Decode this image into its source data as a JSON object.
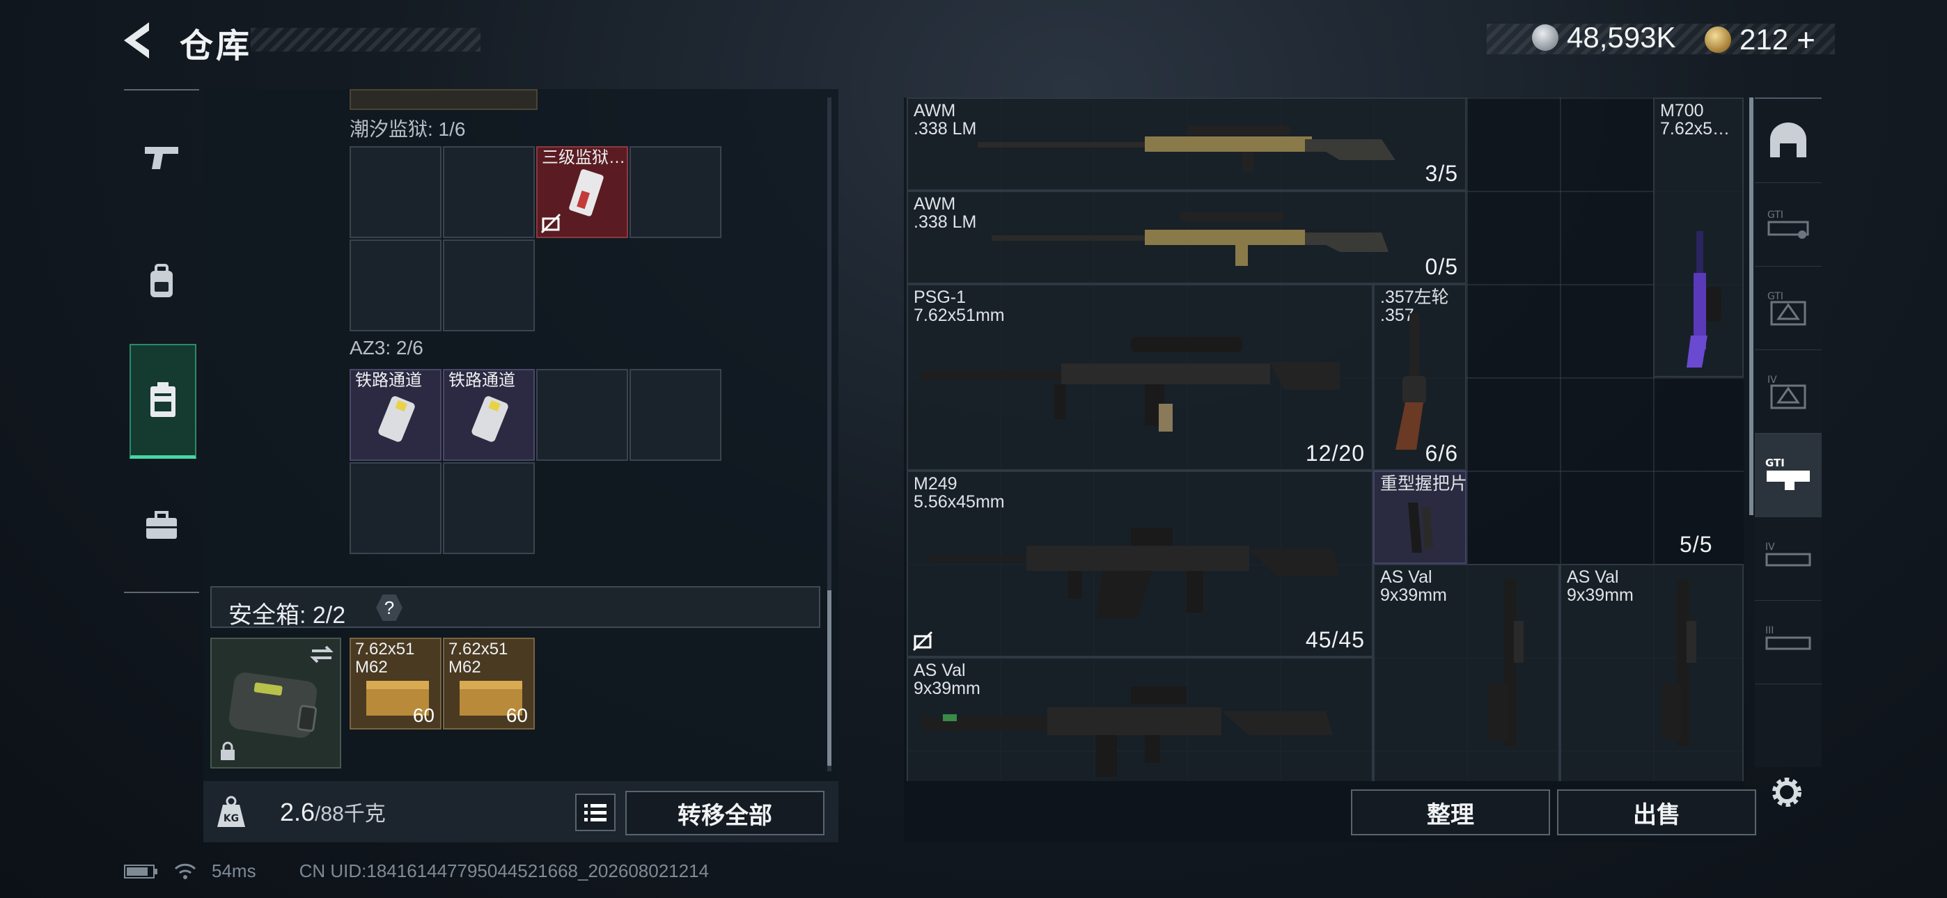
{
  "header": {
    "title": "仓库",
    "currency": [
      {
        "icon": "silver-coin-icon",
        "value": "48,593K"
      },
      {
        "icon": "gold-coin-icon",
        "value": "212",
        "suffix": "+"
      }
    ]
  },
  "left_nav": [
    "pistol-icon",
    "backpack-icon",
    "safe-case-icon",
    "toolbox-icon"
  ],
  "stash": {
    "sections": [
      {
        "label": "潮汐监狱: 1/6",
        "items": [
          {
            "name": "三级监狱…",
            "status": "locked-transfer"
          }
        ]
      },
      {
        "label": "AZ3: 2/6",
        "items": [
          {
            "name": "铁路通道"
          },
          {
            "name": "铁路通道"
          }
        ]
      }
    ],
    "safe_box": {
      "label": "安全箱: 2/2",
      "help": "?",
      "items": [
        {
          "name": "7.62x51\nM62",
          "count": "60"
        },
        {
          "name": "7.62x51\nM62",
          "count": "60"
        }
      ]
    },
    "weight": {
      "value": "2.6",
      "max": "/88千克",
      "kg_label": "KG"
    },
    "transfer_all_label": "转移全部"
  },
  "weapons": {
    "items": [
      {
        "name": "AWM\n.338 LM",
        "count": "3/5"
      },
      {
        "name": "M700\n7.62x5…",
        "count": ""
      },
      {
        "name": "AWM\n.338 LM",
        "count": "0/5"
      },
      {
        "name": "PSG-1\n7.62x51mm",
        "count": "12/20"
      },
      {
        "name": ".357左轮\n.357",
        "count": "6/6"
      },
      {
        "name": "M249\n5.56x45mm",
        "count": "45/45"
      },
      {
        "name": "重型握把片",
        "count": "5/5"
      },
      {
        "name": "AS Val\n9x39mm",
        "count": ""
      },
      {
        "name": "AS Val\n9x39mm",
        "count": ""
      },
      {
        "name": "AS Val\n9x39mm",
        "count": ""
      }
    ],
    "organize_label": "整理",
    "sell_label": "出售"
  },
  "right_nav": [
    "helmet-icon",
    "gti-attachment-icon",
    "gti-sight-icon",
    "iv-sight-icon",
    "gti-rail-icon",
    "iv-rail-icon",
    "iii-rail-icon"
  ],
  "status": {
    "ping": "54ms",
    "uid": "CN UID:18416144779504452166​8_202608021214"
  }
}
